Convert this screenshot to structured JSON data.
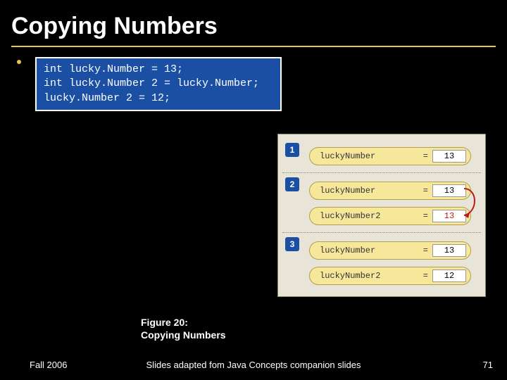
{
  "title": "Copying Numbers",
  "code": {
    "line1": "int lucky.Number = 13;",
    "line2": "int lucky.Number 2 = lucky.Number;",
    "line3": "lucky.Number 2 = 12;"
  },
  "diagram": {
    "steps": [
      {
        "num": "1",
        "rows": [
          {
            "label": "luckyNumber",
            "eq": "=",
            "value": "13",
            "red": false
          }
        ]
      },
      {
        "num": "2",
        "rows": [
          {
            "label": "luckyNumber",
            "eq": "=",
            "value": "13",
            "red": false
          },
          {
            "label": "luckyNumber2",
            "eq": "=",
            "value": "13",
            "red": true
          }
        ]
      },
      {
        "num": "3",
        "rows": [
          {
            "label": "luckyNumber",
            "eq": "=",
            "value": "13",
            "red": false
          },
          {
            "label": "luckyNumber2",
            "eq": "=",
            "value": "12",
            "red": false
          }
        ]
      }
    ]
  },
  "caption": {
    "line1": "Figure 20:",
    "line2": "Copying Numbers"
  },
  "footer": {
    "left": "Fall 2006",
    "mid": "Slides adapted fom Java Concepts companion slides",
    "right": "71"
  }
}
